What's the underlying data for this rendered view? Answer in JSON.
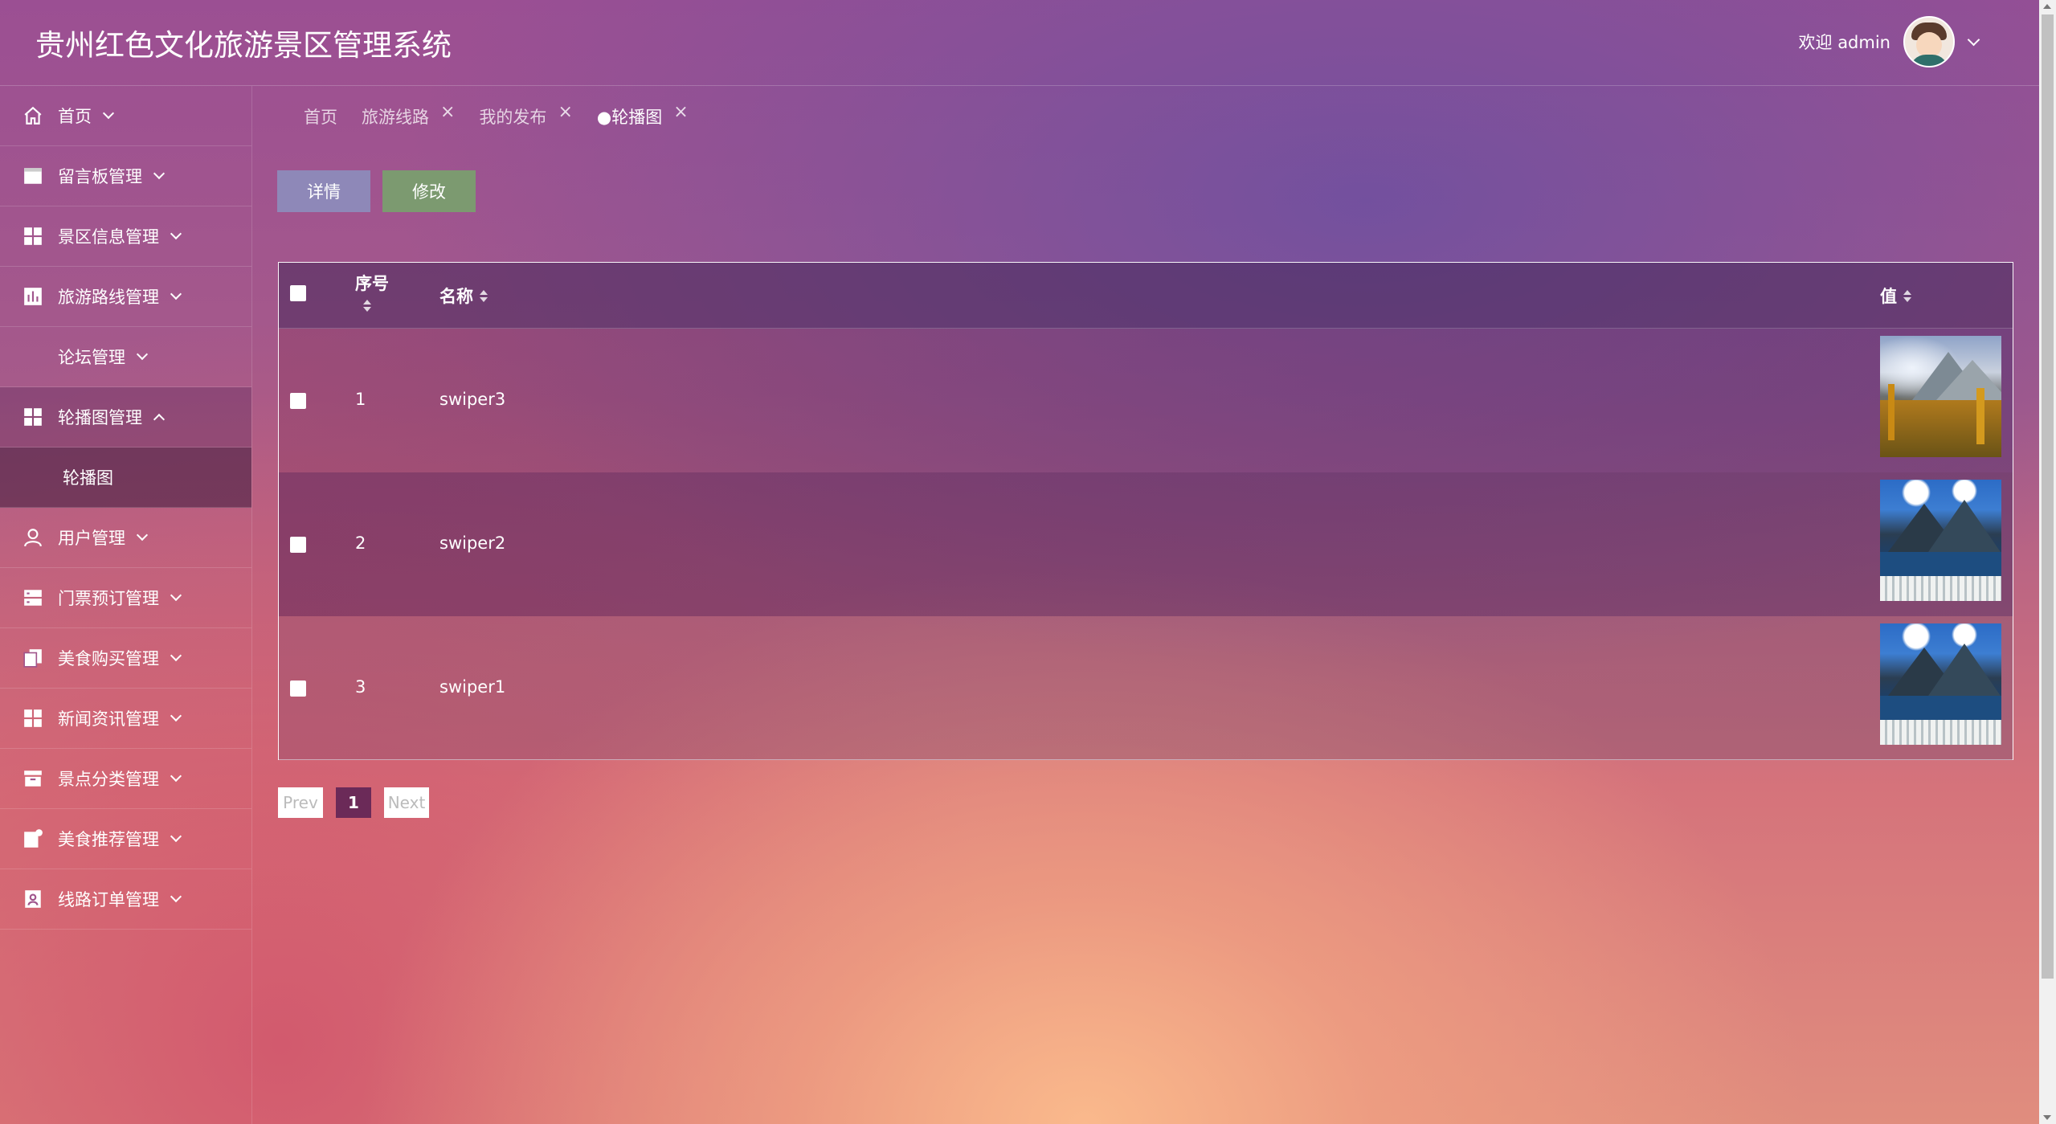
{
  "header": {
    "title": "贵州红色文化旅游景区管理系统",
    "welcome": "欢迎 admin"
  },
  "sidebar": {
    "items": [
      {
        "label": "首页",
        "icon": "home-icon"
      },
      {
        "label": "留言板管理",
        "icon": "message-board-icon"
      },
      {
        "label": "景区信息管理",
        "icon": "grid-icon"
      },
      {
        "label": "旅游路线管理",
        "icon": "chart-icon"
      },
      {
        "label": "论坛管理",
        "icon": ""
      },
      {
        "label": "轮播图管理",
        "icon": "grid-icon",
        "expanded": true
      },
      {
        "label": "用户管理",
        "icon": "user-icon"
      },
      {
        "label": "门票预订管理",
        "icon": "server-icon"
      },
      {
        "label": "美食购买管理",
        "icon": "copy-icon"
      },
      {
        "label": "新闻资讯管理",
        "icon": "grid-icon"
      },
      {
        "label": "景点分类管理",
        "icon": "archive-icon"
      },
      {
        "label": "美食推荐管理",
        "icon": "note-icon"
      },
      {
        "label": "线路订单管理",
        "icon": "contact-icon"
      }
    ],
    "sub_item": "轮播图"
  },
  "tabs": [
    {
      "label": "首页",
      "closable": false
    },
    {
      "label": "旅游线路",
      "closable": true
    },
    {
      "label": "我的发布",
      "closable": true
    },
    {
      "label": "●轮播图",
      "closable": true,
      "active": true
    }
  ],
  "toolbar": {
    "detail_label": "详情",
    "edit_label": "修改"
  },
  "table": {
    "headers": {
      "index": "序号",
      "name": "名称",
      "value": "值"
    },
    "rows": [
      {
        "index": "1",
        "name": "swiper3",
        "image": "autumn-mountain"
      },
      {
        "index": "2",
        "name": "swiper2",
        "image": "mountain-lake"
      },
      {
        "index": "3",
        "name": "swiper1",
        "image": "mountain-lake"
      }
    ]
  },
  "pager": {
    "prev": "Prev",
    "current": "1",
    "next": "Next"
  },
  "colors": {
    "detail_button": "#8e88b8",
    "edit_button": "#7c9a70",
    "pager_current": "#6b2a58"
  }
}
